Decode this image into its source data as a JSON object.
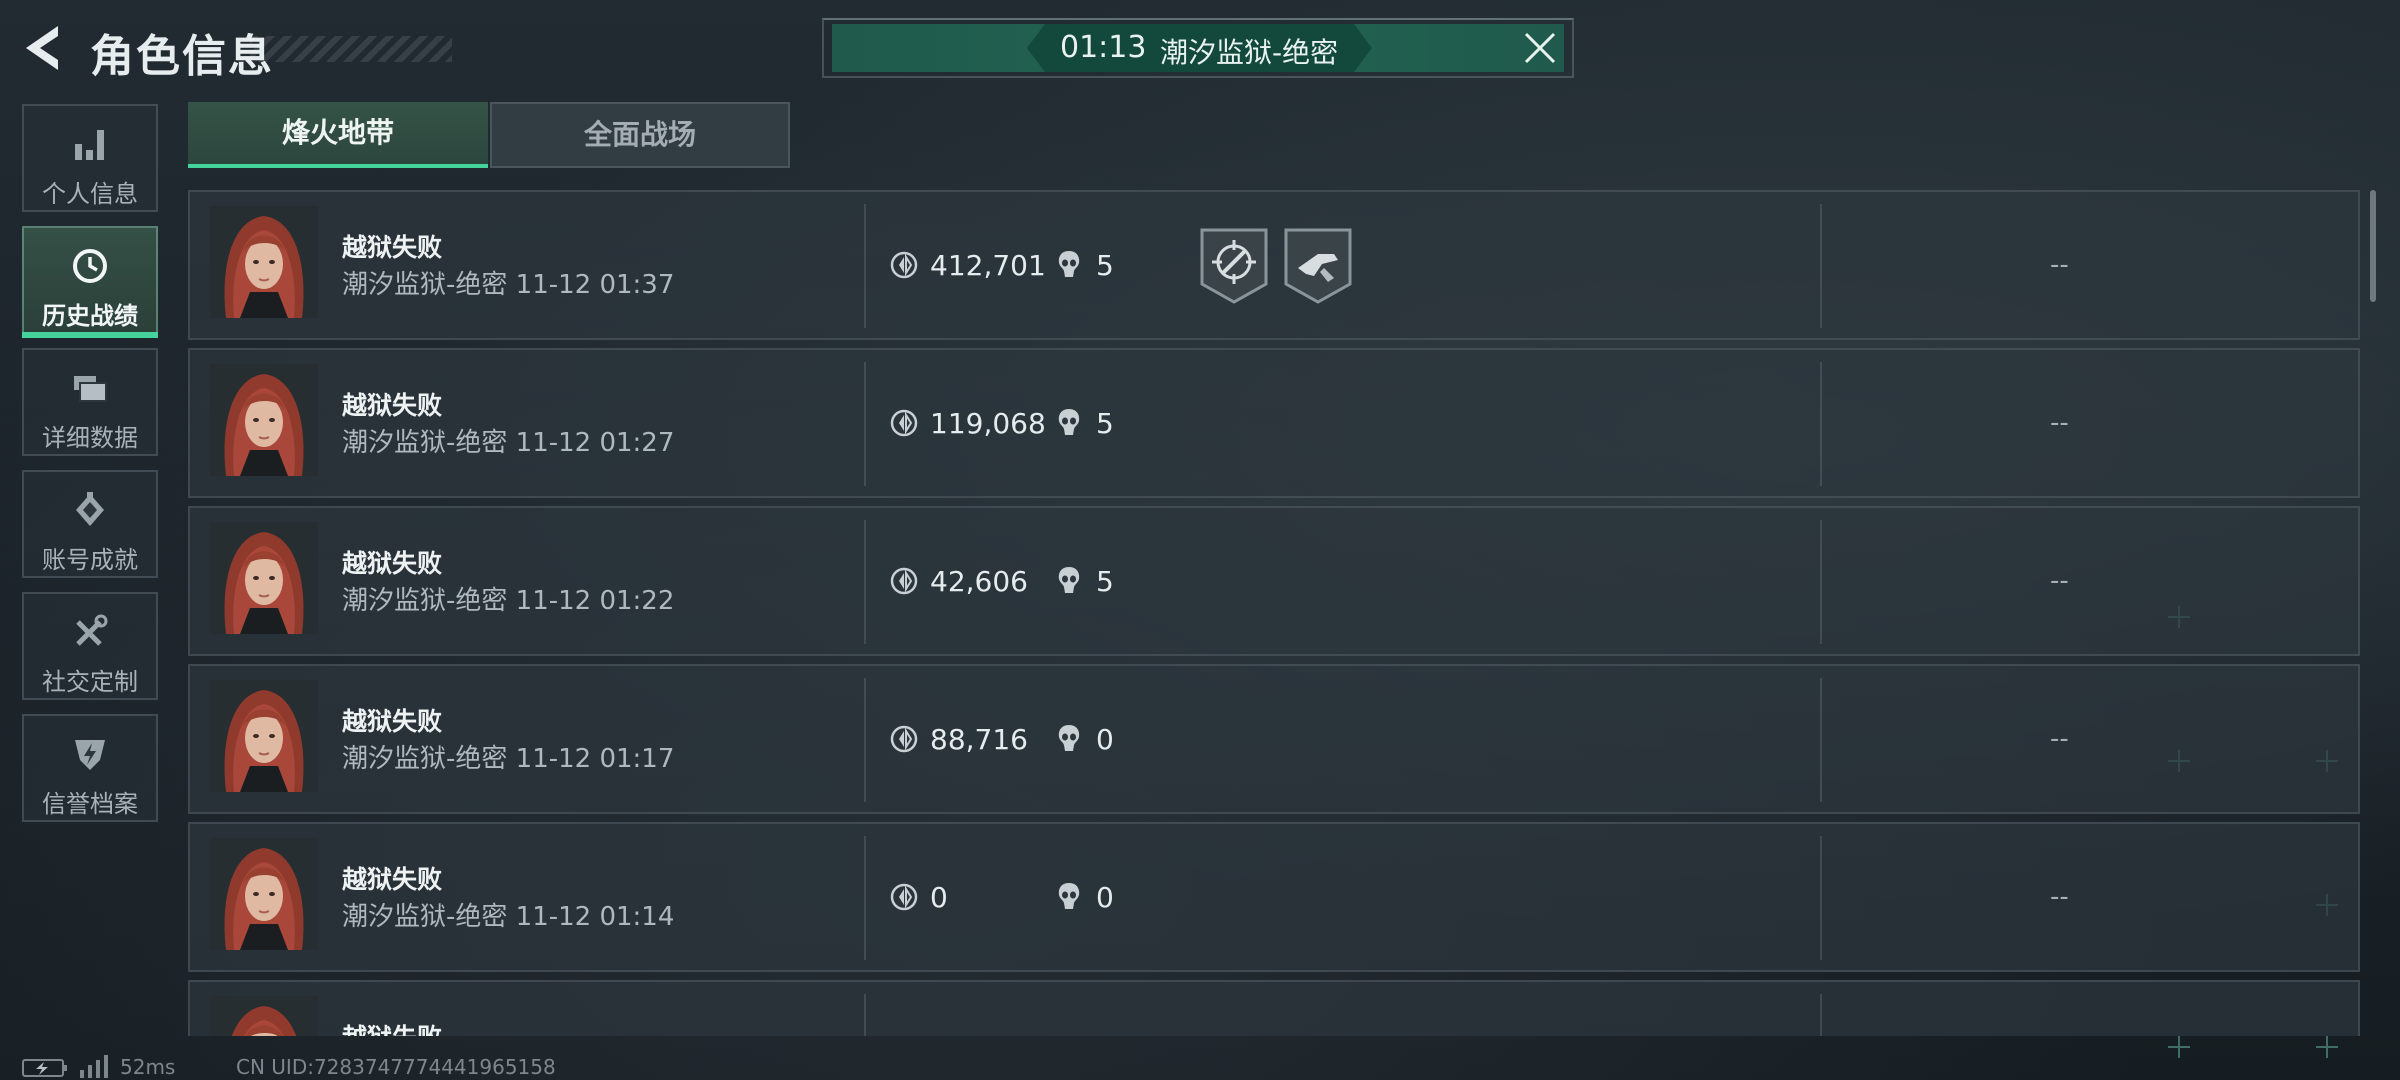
{
  "header": {
    "title": "角色信息",
    "match_banner": {
      "time": "01:13",
      "map": "潮汐监狱-绝密"
    }
  },
  "nav": {
    "items": [
      {
        "label": "个人信息",
        "icon": "bar-chart-icon"
      },
      {
        "label": "历史战绩",
        "icon": "history-clock-icon",
        "active": true
      },
      {
        "label": "详细数据",
        "icon": "stacked-cards-icon"
      },
      {
        "label": "账号成就",
        "icon": "achievement-diamond-icon"
      },
      {
        "label": "社交定制",
        "icon": "tools-icon"
      },
      {
        "label": "信誉档案",
        "icon": "shield-bolt-icon"
      }
    ]
  },
  "tabs": [
    {
      "label": "烽火地带",
      "active": true
    },
    {
      "label": "全面战场",
      "active": false
    }
  ],
  "records": [
    {
      "result": "越狱失败",
      "map_time": "潮汐监狱-绝密 11-12 01:37",
      "value": "412,701",
      "kills": "5",
      "badges": [
        "crosshair-badge-icon",
        "weapon-badge-icon"
      ],
      "extra": "--"
    },
    {
      "result": "越狱失败",
      "map_time": "潮汐监狱-绝密 11-12 01:27",
      "value": "119,068",
      "kills": "5",
      "badges": [],
      "extra": "--"
    },
    {
      "result": "越狱失败",
      "map_time": "潮汐监狱-绝密 11-12 01:22",
      "value": "42,606",
      "kills": "5",
      "badges": [],
      "extra": "--"
    },
    {
      "result": "越狱失败",
      "map_time": "潮汐监狱-绝密 11-12 01:17",
      "value": "88,716",
      "kills": "0",
      "badges": [],
      "extra": "--"
    },
    {
      "result": "越狱失败",
      "map_time": "潮汐监狱-绝密 11-12 01:14",
      "value": "0",
      "kills": "0",
      "badges": [],
      "extra": "--"
    },
    {
      "result": "越狱失败",
      "map_time": "",
      "value": "",
      "kills": "",
      "badges": [],
      "extra": ""
    }
  ],
  "footer": {
    "ping": "52ms",
    "uid": "CN UID:7283747774441965158"
  },
  "colors": {
    "accent_green": "#44d39c",
    "banner_green": "#236352",
    "background": "#1b2329"
  }
}
